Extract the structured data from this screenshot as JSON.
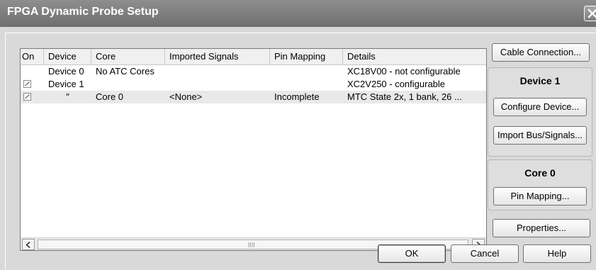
{
  "window": {
    "title": "FPGA Dynamic Probe Setup"
  },
  "list": {
    "columns": [
      "On",
      "Device",
      "Core",
      "Imported Signals",
      "Pin Mapping",
      "Details"
    ],
    "rows": [
      {
        "checked": false,
        "show_checkbox": false,
        "device": "Device 0",
        "core": "No ATC Cores",
        "signals": "",
        "pin_mapping": "",
        "details": "XC18V00 - not configurable",
        "selected": false
      },
      {
        "checked": true,
        "show_checkbox": true,
        "device": "Device 1",
        "core": "",
        "signals": "",
        "pin_mapping": "",
        "details": "XC2V250 - configurable",
        "selected": false
      },
      {
        "checked": true,
        "show_checkbox": true,
        "device": "\"",
        "core": "Core 0",
        "signals": "<None>",
        "pin_mapping": "Incomplete",
        "details": "MTC State 2x, 1 bank, 26 ...",
        "selected": true
      }
    ]
  },
  "side": {
    "cable_connection": "Cable Connection...",
    "device_group_title": "Device 1",
    "configure_device": "Configure Device...",
    "import_bus_signals": "Import Bus/Signals...",
    "core_group_title": "Core 0",
    "pin_mapping": "Pin Mapping...",
    "properties": "Properties..."
  },
  "footer": {
    "ok": "OK",
    "cancel": "Cancel",
    "help": "Help"
  },
  "icons": {
    "close": "close-icon",
    "checkbox": "checkmark-icon",
    "scroll_left": "arrow-left-icon",
    "scroll_right": "arrow-right-icon"
  }
}
